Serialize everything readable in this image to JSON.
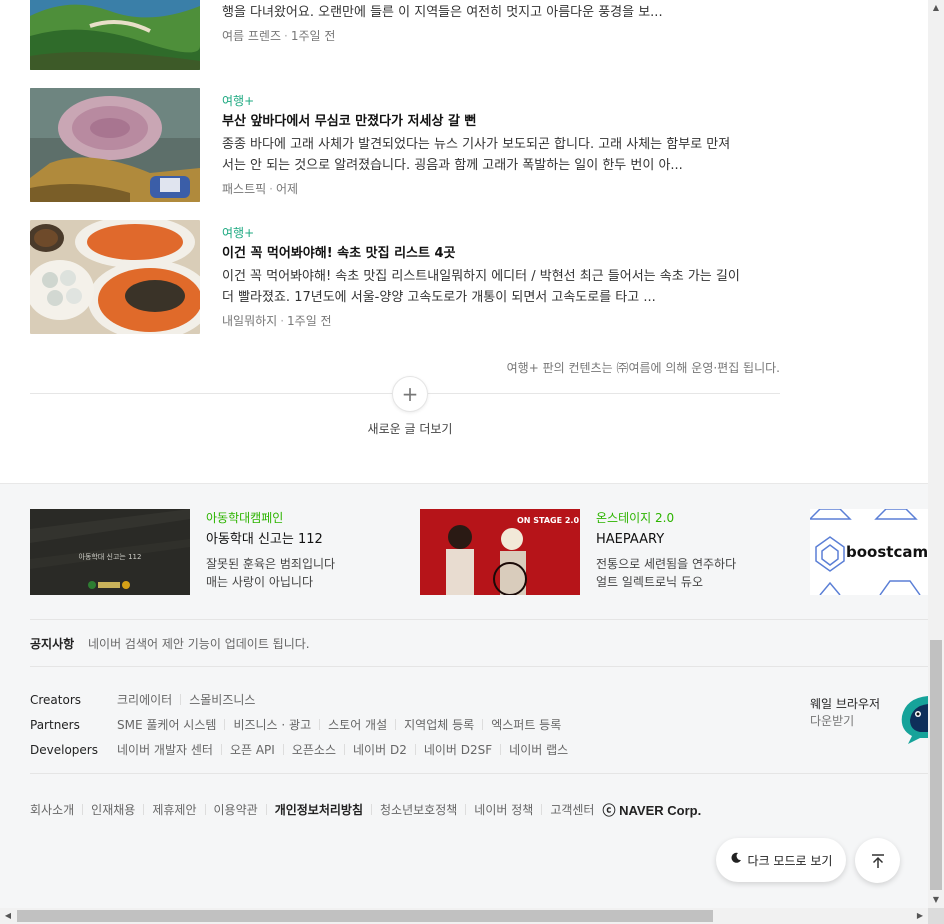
{
  "articles": [
    {
      "category": "",
      "title": "",
      "desc": "안녕하세요. '쓰쓰유의 여행을 말하다' 입니다. 조금 이른 휴가를 맞아 경상남도 통영과 거제로 여행을 다녀왔어요. 오랜만에 들른 이 지역들은 여전히 멋지고 아름다운 풍경을 보...",
      "author": "여름 프렌즈",
      "time": "1주일 전"
    },
    {
      "category": "여행+",
      "title": "부산 앞바다에서 무심코 만졌다가 저세상 갈 뻔",
      "desc": "종종 바다에 고래 사체가 발견되었다는 뉴스 기사가 보도되곤 합니다. 고래 사체는 함부로 만져서는 안 되는 것으로 알려졌습니다. 굉음과 함께 고래가 폭발하는 일이 한두 번이 아...",
      "author": "패스트픽",
      "time": "어제"
    },
    {
      "category": "여행+",
      "title": "이건 꼭 먹어봐야해! 속초 맛집 리스트 4곳",
      "desc": "이건 꼭 먹어봐야해! 속초 맛집 리스트내일뭐하지 에디터 / 박현선 최근 들어서는 속초 가는 길이 더 빨라졌죠. 17년도에 서울-양양 고속도로가 개통이 되면서 고속도로를 타고 ...",
      "author": "내일뭐하지",
      "time": "1주일 전"
    }
  ],
  "meta_separator": "·",
  "operation_notice": "여행+ 판의 컨텐츠는 ㈜여름에 의해 운영·편집 됩니다.",
  "more": {
    "icon": "+",
    "label": "새로운 글 더보기"
  },
  "promos": [
    {
      "image_text": "아동학대 신고는 112",
      "category": "아동학대캠페인",
      "title": "아동학대 신고는 112",
      "desc1": "잘못된 훈육은 범죄입니다",
      "desc2": "매는 사랑이 아닙니다"
    },
    {
      "image_text": "ON STAGE 2.0",
      "category": "온스테이지 2.0",
      "title": "HAEPAARY",
      "desc1": "전통으로 세련됨을 연주하다",
      "desc2": "얼트 일렉트로닉 듀오"
    },
    {
      "image_text": "boostcamp"
    }
  ],
  "notice": {
    "label": "공지사항",
    "text": "네이버 검색어 제안 기능이 업데이트 됩니다."
  },
  "link_rows": [
    {
      "name": "Creators",
      "items": [
        "크리에이터",
        "스몰비즈니스"
      ]
    },
    {
      "name": "Partners",
      "items": [
        "SME 풀케어 시스템",
        "비즈니스 · 광고",
        "스토어 개설",
        "지역업체 등록",
        "엑스퍼트 등록"
      ]
    },
    {
      "name": "Developers",
      "items": [
        "네이버 개발자 센터",
        "오픈 API",
        "오픈소스",
        "네이버 D2",
        "네이버 D2SF",
        "네이버 랩스"
      ]
    }
  ],
  "whale": {
    "title": "웨일 브라우저",
    "sub": "다운받기"
  },
  "bottom_links": [
    "회사소개",
    "인재채용",
    "제휴제안",
    "이용약관",
    "개인정보처리방침",
    "청소년보호정책",
    "네이버 정책",
    "고객센터"
  ],
  "copyright": "ⓒ NAVER Corp.",
  "dark_mode_label": "다크 모드로 보기",
  "colors": {
    "accent_green": "#1faa82",
    "promo_green": "#2db400"
  }
}
